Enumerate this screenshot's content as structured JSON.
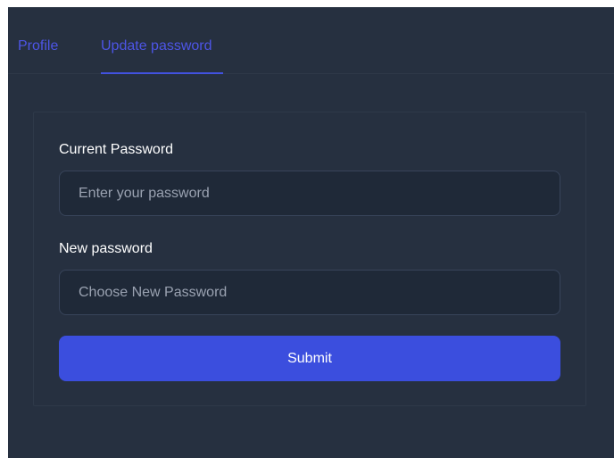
{
  "tabs": [
    {
      "label": "Profile",
      "active": false
    },
    {
      "label": "Update password",
      "active": true
    }
  ],
  "form": {
    "current_password": {
      "label": "Current Password",
      "value": "",
      "placeholder": "Enter your password"
    },
    "new_password": {
      "label": "New password",
      "value": "",
      "placeholder": "Choose New Password"
    },
    "submit_label": "Submit"
  },
  "colors": {
    "background": "#263040",
    "accent": "#3b4ede",
    "tab_active": "#4d55e6",
    "input_background": "#1f2938",
    "input_border": "#38445a",
    "placeholder": "#9aa2b1",
    "label": "#ffffff"
  }
}
